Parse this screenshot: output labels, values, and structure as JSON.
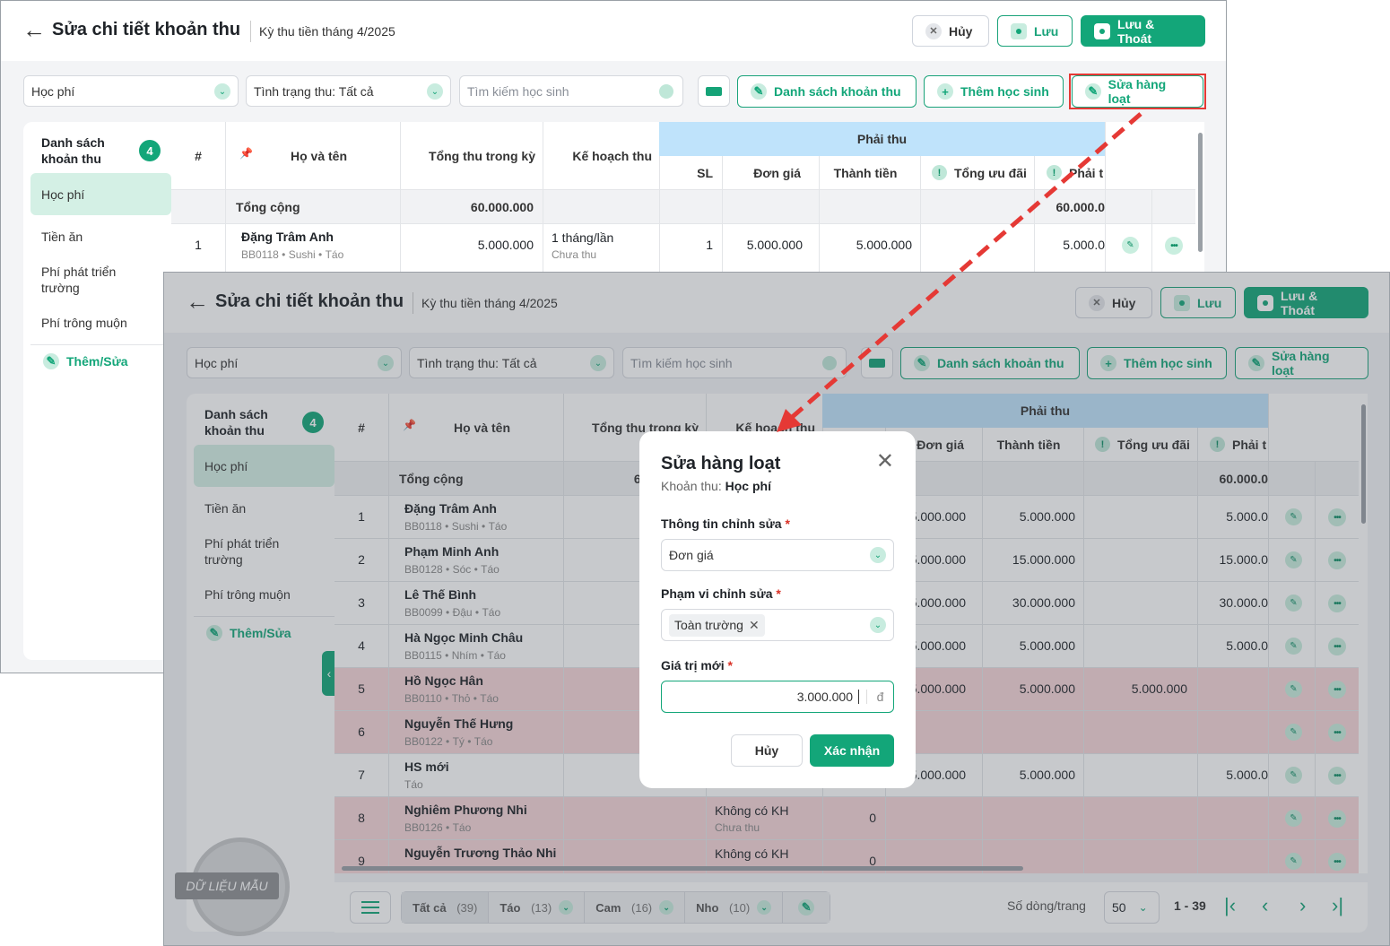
{
  "header": {
    "title": "Sửa chi tiết khoản thu",
    "period": "Kỳ thu tiền tháng 4/2025",
    "cancel_label": "Hủy",
    "save_label": "Lưu",
    "save_exit_label": "Lưu & Thoát"
  },
  "filters": {
    "fee_select": "Học phí",
    "status_select": "Tình trạng thu: Tất cả",
    "search_placeholder": "Tìm kiếm học sinh"
  },
  "actions": {
    "fee_list": "Danh sách khoản thu",
    "add_student": "Thêm học sinh",
    "bulk_edit": "Sửa hàng loạt"
  },
  "sidebar": {
    "title": "Danh sách khoản thu",
    "count": "4",
    "items": [
      {
        "label": "Học phí"
      },
      {
        "label": "Tiền ăn"
      },
      {
        "label": "Phí phát triển trường"
      },
      {
        "label": "Phí trông muộn"
      }
    ],
    "add_label": "Thêm/Sửa"
  },
  "table": {
    "group_header": "Phải thu",
    "headers": {
      "idx": "#",
      "name": "Họ và tên",
      "total": "Tổng thu trong kỳ",
      "plan": "Kế hoạch thu",
      "qty": "SL",
      "price": "Đơn giá",
      "amount": "Thành tiền",
      "discount": "Tổng ưu đãi",
      "due": "Phải t"
    },
    "sum_row": {
      "label": "Tổng cộng",
      "total": "60.000.000",
      "due": "60.000.0"
    },
    "top_row": {
      "idx": "1",
      "name": "Đặng Trâm Anh",
      "code": "BB0118",
      "tags": "Sushi",
      "tag2": "Táo",
      "total": "5.000.000",
      "plan": "1 tháng/lần",
      "plan_status": "Chưa thu",
      "qty": "1",
      "price": "5.000.000",
      "amount": "5.000.000",
      "due": "5.000.0"
    },
    "rows": [
      {
        "idx": "1",
        "name": "Đặng Trâm Anh",
        "code": "BB0118",
        "t1": "Sushi",
        "t2": "Táo",
        "total": "5",
        "price": ".5.000.000",
        "amount": "5.000.000",
        "discount": "",
        "due": "5.000.0"
      },
      {
        "idx": "2",
        "name": "Phạm Minh Anh",
        "code": "BB0128",
        "t1": "Sóc",
        "t2": "Táo",
        "total": "15",
        "price": ".5.000.000",
        "amount": "15.000.000",
        "discount": "",
        "due": "15.000.0"
      },
      {
        "idx": "3",
        "name": "Lê Thế Bình",
        "code": "BB0099",
        "t1": "Đậu",
        "t2": "Táo",
        "total": "30",
        "price": ".5.000.000",
        "amount": "30.000.000",
        "discount": "",
        "due": "30.000.0"
      },
      {
        "idx": "4",
        "name": "Hà Ngọc Minh Châu",
        "code": "BB0115",
        "t1": "Nhím",
        "t2": "Táo",
        "total": "5",
        "price": ".5.000.000",
        "amount": "5.000.000",
        "discount": "",
        "due": "5.000.0"
      },
      {
        "idx": "5",
        "name": "Hồ Ngọc Hân",
        "code": "BB0110",
        "t1": "Thỏ",
        "t2": "Táo",
        "total": "",
        "price": ".5.000.000",
        "amount": "5.000.000",
        "discount": "5.000.000",
        "due": ""
      },
      {
        "idx": "6",
        "name": "Nguyễn Thế Hưng",
        "code": "BB0122",
        "t1": "Tý",
        "t2": "Táo",
        "total": "",
        "price": "",
        "amount": "",
        "discount": "",
        "due": ""
      },
      {
        "idx": "7",
        "name": "HS mới",
        "code": "",
        "t1": "",
        "t2": "Táo",
        "total": "",
        "price": ".5.000.000",
        "amount": "5.000.000",
        "discount": "",
        "due": "5.000.0"
      },
      {
        "idx": "8",
        "name": "Nghiêm Phương Nhi",
        "code": "BB0126",
        "t1": "",
        "t2": "Táo",
        "total": "",
        "plan": "Không có KH",
        "plan_status": "Chưa thu",
        "qty": "0",
        "price": "",
        "amount": "",
        "discount": "",
        "due": ""
      },
      {
        "idx": "9",
        "name": "Nguyễn Trương Thảo Nhi",
        "code": "",
        "t1": "",
        "t2": "",
        "total": "",
        "plan": "Không có KH",
        "plan_status": "",
        "qty": "0",
        "price": "",
        "amount": "",
        "discount": "",
        "due": ""
      }
    ]
  },
  "footer": {
    "all_label": "Tất cả",
    "all_count": "(39)",
    "g1_label": "Táo",
    "g1_count": "(13)",
    "g2_label": "Cam",
    "g2_count": "(16)",
    "g3_label": "Nho",
    "g3_count": "(10)",
    "rows_per_page_label": "Số dòng/trang",
    "rows_per_page": "50",
    "range": "1 - 39"
  },
  "modal": {
    "title": "Sửa hàng loạt",
    "subtitle_prefix": "Khoản thu:",
    "subtitle_value": "Học phí",
    "field1_label": "Thông tin chỉnh sửa",
    "field1_value": "Đơn giá",
    "field2_label": "Phạm vi chỉnh sửa",
    "field2_tag": "Toàn trường",
    "field3_label": "Giá trị mới",
    "field3_value": "3.000.000",
    "field3_unit": "đ",
    "required_mark": "*",
    "cancel_label": "Hủy",
    "confirm_label": "Xác nhận"
  },
  "watermark": "DỮ LIỆU MẪU",
  "colors": {
    "accent": "#13a679",
    "highlight_red": "#e53935",
    "header_blue": "#bfe3fb",
    "row_pink": "#f6d6d9"
  }
}
